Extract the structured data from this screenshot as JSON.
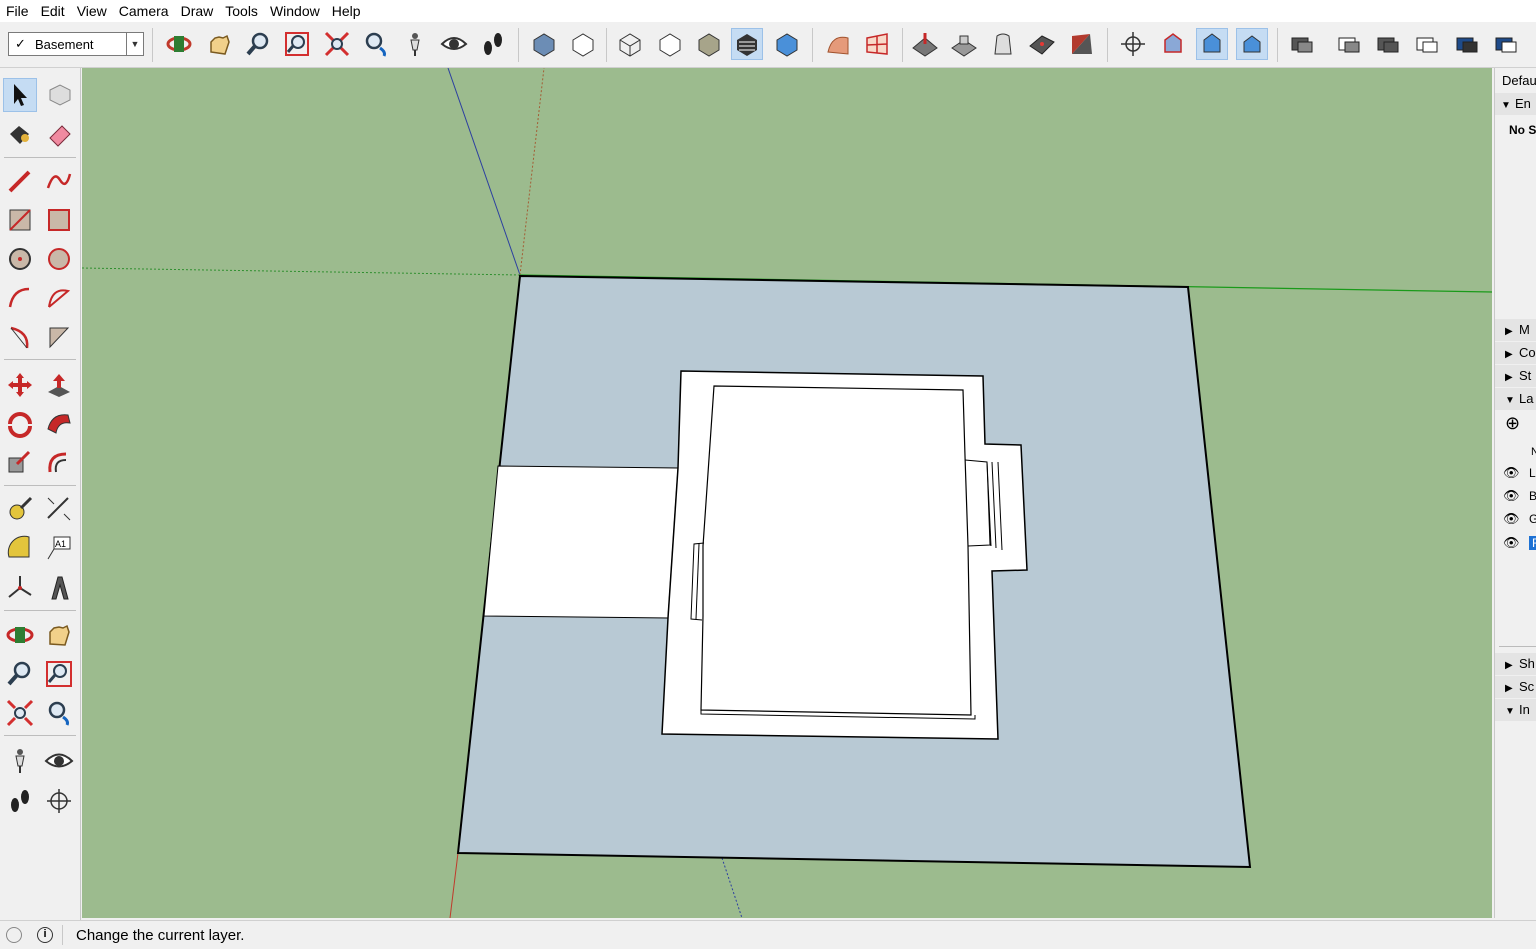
{
  "menu": [
    "File",
    "Edit",
    "View",
    "Camera",
    "Draw",
    "Tools",
    "Window",
    "Help"
  ],
  "toolbar": {
    "layer_checkmark": "✓",
    "current_layer": "Basement",
    "icons": [
      "orbit-icon",
      "pan-icon",
      "zoom-icon",
      "zoom-window-icon",
      "zoom-extents-icon",
      "previous-view-icon",
      "position-camera-icon",
      "look-around-icon",
      "walk-icon",
      "xray-icon",
      "back-edges-icon",
      "wireframe-icon",
      "hidden-line-icon",
      "shaded-icon",
      "shaded-textures-icon",
      "monochrome-icon",
      "sandbox-from-contours-icon",
      "sandbox-from-scratch-icon",
      "smoove-icon",
      "stamp-icon",
      "drape-icon",
      "add-detail-icon",
      "flip-edge-icon",
      "axes-icon",
      "iso-view-icon",
      "top-view-icon",
      "front-view-icon",
      "section-plane-icon",
      "section-cut-icon",
      "section-fill-icon",
      "section-display-icon",
      "solid-union-icon",
      "solid-subtract-icon"
    ]
  },
  "left_tools": [
    "select-icon",
    "make-component-icon",
    "paint-bucket-icon",
    "eraser-icon",
    "line-icon",
    "freehand-icon",
    "rectangle-icon",
    "rotated-rectangle-icon",
    "circle-icon",
    "polygon-icon",
    "arc-icon",
    "two-point-arc-icon",
    "pie-icon",
    "three-point-arc-icon",
    "move-icon",
    "push-pull-icon",
    "rotate-icon",
    "follow-me-icon",
    "scale-icon",
    "offset-icon",
    "tape-measure-icon",
    "dimension-icon",
    "protractor-icon",
    "text-icon",
    "axes-icon",
    "3d-text-icon",
    "orbit-icon",
    "pan-icon",
    "zoom-icon",
    "zoom-window-icon",
    "zoom-extents-icon",
    "previous-icon",
    "position-camera-icon",
    "look-around-icon",
    "walk-icon",
    "section-plane-icon"
  ],
  "right_panel": {
    "tray_title": "Defau",
    "entity_section": "En",
    "no_selection": "No S",
    "sections": [
      "M",
      "Co",
      "St",
      "La"
    ],
    "layers_add": "⊕",
    "layer_col_header": "N",
    "layers": [
      {
        "name": "L",
        "visible": true
      },
      {
        "name": "B",
        "visible": true
      },
      {
        "name": "G",
        "visible": true
      },
      {
        "name": "F",
        "visible": true,
        "selected": true
      }
    ],
    "bottom_sections": [
      {
        "label": "Sh",
        "expanded": false
      },
      {
        "label": "Sc",
        "expanded": false
      },
      {
        "label": "In",
        "expanded": true
      }
    ]
  },
  "status": {
    "text": "Change the current layer."
  },
  "colors": {
    "ground": "#9cbb8e",
    "plot": "#b8c9d4",
    "building": "#ffffff",
    "accent": "#c5dcf3"
  }
}
